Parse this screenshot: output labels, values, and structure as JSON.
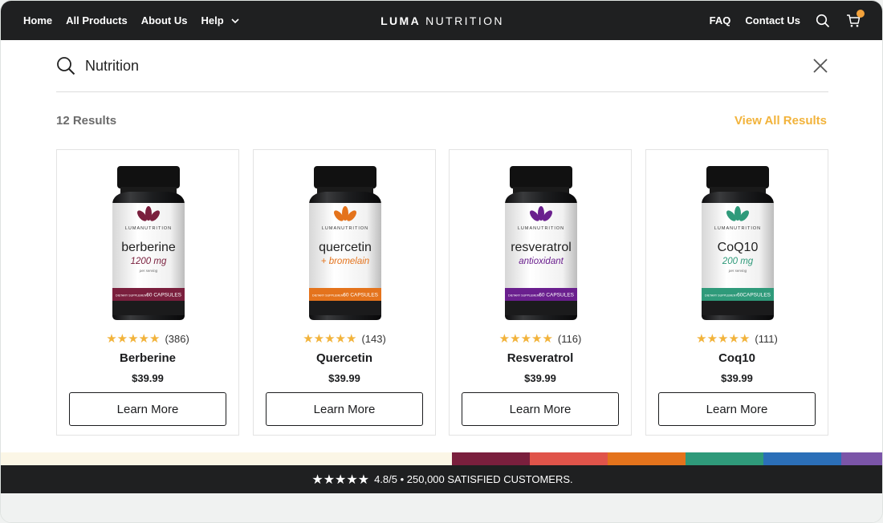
{
  "nav": {
    "left": [
      "Home",
      "All Products",
      "About Us",
      "Help"
    ],
    "brand_bold": "LUMA",
    "brand_light": "NUTRITION",
    "right": [
      "FAQ",
      "Contact Us"
    ],
    "icons": [
      "search-icon",
      "cart-icon"
    ]
  },
  "search": {
    "value": "Nutrition",
    "placeholder": "Search"
  },
  "results": {
    "count_label": "12 Results",
    "view_all_label": "View All Results"
  },
  "products": [
    {
      "name": "Berberine",
      "stars": "★★★★★",
      "reviews": "(386)",
      "price": "$39.99",
      "cta": "Learn More",
      "bottle": {
        "brand": "LUMANUTRITION",
        "line1": "berberine",
        "line2": "1200 mg",
        "line3": "per serving",
        "band": "60 CAPSULES",
        "band_small": "DIETARY SUPPLEMENT"
      },
      "colors": {
        "accent": "#7a1f3d",
        "text2": "#7a1f3d"
      }
    },
    {
      "name": "Quercetin",
      "stars": "★★★★★",
      "reviews": "(143)",
      "price": "$39.99",
      "cta": "Learn More",
      "bottle": {
        "brand": "LUMANUTRITION",
        "line1": "quercetin",
        "line2": "+ bromelain",
        "line3": "",
        "band": "60 CAPSULES",
        "band_small": "DIETARY SUPPLEMENT"
      },
      "colors": {
        "accent": "#e4731c",
        "text2": "#e4731c"
      }
    },
    {
      "name": "Resveratrol",
      "stars": "★★★★★",
      "reviews": "(116)",
      "price": "$39.99",
      "cta": "Learn More",
      "bottle": {
        "brand": "LUMANUTRITION",
        "line1": "resveratrol",
        "line2": "antioxidant",
        "line3": "",
        "band": "60 CAPSULES",
        "band_small": "DIETARY SUPPLEMENT"
      },
      "colors": {
        "accent": "#6a1f8e",
        "text2": "#6a1f8e"
      }
    },
    {
      "name": "Coq10",
      "stars": "★★★★★",
      "reviews": "(111)",
      "price": "$39.99",
      "cta": "Learn More",
      "bottle": {
        "brand": "LUMANUTRITION",
        "line1": "CoQ10",
        "line2": "200 mg",
        "line3": "per serving",
        "band": "60CAPSULES",
        "band_small": "DIETARY SUPPLEMENT"
      },
      "colors": {
        "accent": "#2f9a7a",
        "text2": "#2f9a7a"
      }
    }
  ],
  "banner": {
    "stars": "★★★★★",
    "text": "4.8/5 • 250,000 SATISFIED CUSTOMERS."
  },
  "stripe_colors": [
    "#7a1f3d",
    "#e0544a",
    "#e4731c",
    "#2f9a7a",
    "#2b6fb8",
    "#7b55a8"
  ],
  "theme": {
    "dark": "#1f2021",
    "gold": "#f2b33b"
  }
}
